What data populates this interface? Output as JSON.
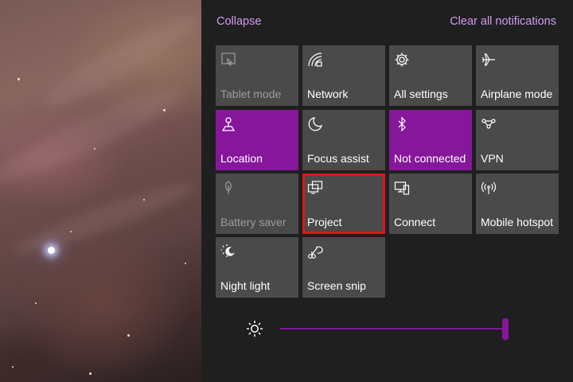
{
  "header": {
    "collapse_label": "Collapse",
    "clear_label": "Clear all notifications"
  },
  "tiles": [
    {
      "label": "Tablet mode",
      "icon": "tablet-mode-icon",
      "state": "disabled"
    },
    {
      "label": "Network",
      "icon": "network-icon",
      "state": "off"
    },
    {
      "label": "All settings",
      "icon": "gear-icon",
      "state": "off"
    },
    {
      "label": "Airplane mode",
      "icon": "airplane-icon",
      "state": "off"
    },
    {
      "label": "Location",
      "icon": "location-icon",
      "state": "on"
    },
    {
      "label": "Focus assist",
      "icon": "moon-icon",
      "state": "off"
    },
    {
      "label": "Not connected",
      "icon": "bluetooth-icon",
      "state": "on"
    },
    {
      "label": "VPN",
      "icon": "vpn-icon",
      "state": "off"
    },
    {
      "label": "Battery saver",
      "icon": "battery-saver-icon",
      "state": "disabled"
    },
    {
      "label": "Project",
      "icon": "project-icon",
      "state": "off",
      "highlighted": true
    },
    {
      "label": "Connect",
      "icon": "connect-icon",
      "state": "off"
    },
    {
      "label": "Mobile hotspot",
      "icon": "hotspot-icon",
      "state": "off"
    },
    {
      "label": "Night light",
      "icon": "night-light-icon",
      "state": "off"
    },
    {
      "label": "Screen snip",
      "icon": "screen-snip-icon",
      "state": "off"
    }
  ],
  "brightness": {
    "icon": "sun-icon",
    "level": 1.0
  },
  "colors": {
    "accent": "#86179b",
    "tile_off": "#4a4a4a",
    "panel_bg": "#1f1f1f",
    "link": "#d59bf0",
    "highlight_border": "#e0161b"
  }
}
